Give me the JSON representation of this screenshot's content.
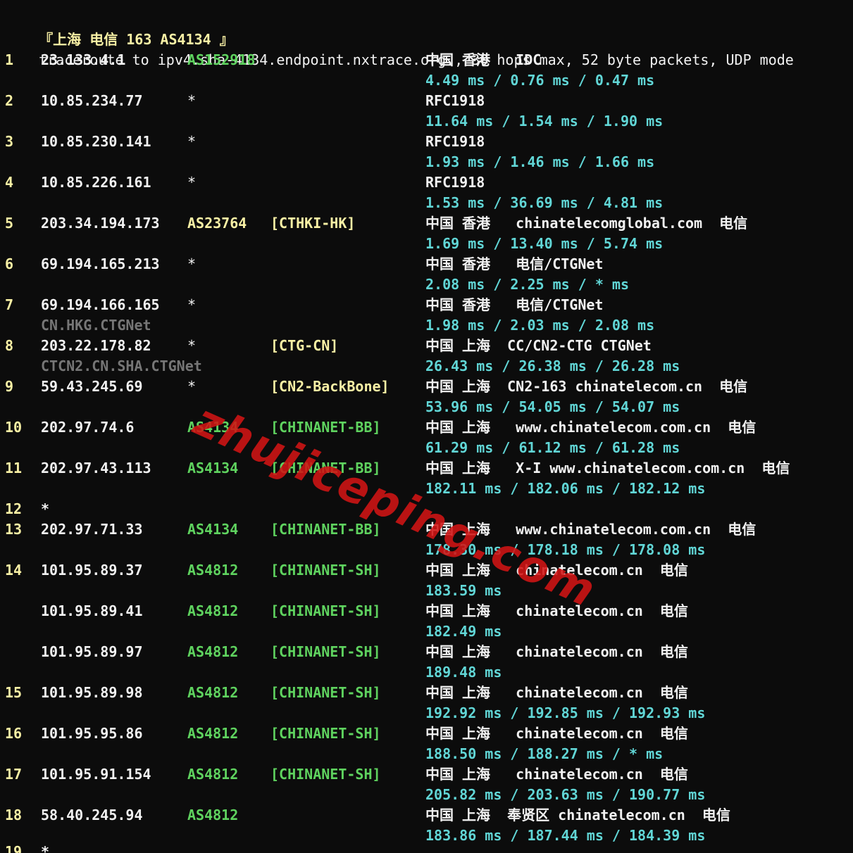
{
  "header": {
    "title": "『上海 电信 163 AS4134 』",
    "command": "traceroute to ipv4.sha-4134.endpoint.nxtrace.org., 30 hops max, 52 byte packets, UDP mode"
  },
  "watermark": "zhujiceping.com",
  "colors": {
    "hop": "#f9f1a5",
    "asn": "#5fd35f",
    "rtt": "#61d6d6",
    "rdns": "#767676",
    "background": "#0c0c0c"
  },
  "rows": [
    {
      "hop": "1",
      "ip": "23.133.4.1",
      "asn": "AS152918",
      "tag": "",
      "geo": "中国 香港   IDC",
      "rtt": "4.49 ms / 0.76 ms / 0.47 ms",
      "rdns": ""
    },
    {
      "hop": "2",
      "ip": "10.85.234.77",
      "asn": "*",
      "tag": "",
      "geo": "RFC1918",
      "rtt": "11.64 ms / 1.54 ms / 1.90 ms",
      "rdns": ""
    },
    {
      "hop": "3",
      "ip": "10.85.230.141",
      "asn": "*",
      "tag": "",
      "geo": "RFC1918",
      "rtt": "1.93 ms / 1.46 ms / 1.66 ms",
      "rdns": ""
    },
    {
      "hop": "4",
      "ip": "10.85.226.161",
      "asn": "*",
      "tag": "",
      "geo": "RFC1918",
      "rtt": "1.53 ms / 36.69 ms / 4.81 ms",
      "rdns": ""
    },
    {
      "hop": "5",
      "ip": "203.34.194.173",
      "asn": "AS23764",
      "tag": "[CTHKI-HK]",
      "geo": "中国 香港   chinatelecomglobal.com  电信",
      "rtt": "1.69 ms / 13.40 ms / 5.74 ms",
      "rdns": ""
    },
    {
      "hop": "6",
      "ip": "69.194.165.213",
      "asn": "*",
      "tag": "",
      "geo": "中国 香港   电信/CTGNet",
      "rtt": "2.08 ms / 2.25 ms / * ms",
      "rdns": ""
    },
    {
      "hop": "7",
      "ip": "69.194.166.165",
      "asn": "*",
      "tag": "",
      "geo": "中国 香港   电信/CTGNet",
      "rtt": "1.98 ms / 2.03 ms / 2.08 ms",
      "rdns": "CN.HKG.CTGNet"
    },
    {
      "hop": "8",
      "ip": "203.22.178.82",
      "asn": "*",
      "tag": "[CTG-CN]",
      "geo": "中国 上海  CC/CN2-CTG CTGNet",
      "rtt": "26.43 ms / 26.38 ms / 26.28 ms",
      "rdns": "CTCN2.CN.SHA.CTGNet"
    },
    {
      "hop": "9",
      "ip": "59.43.245.69",
      "asn": "*",
      "tag": "[CN2-BackBone]",
      "geo": "中国 上海  CN2-163 chinatelecom.cn  电信",
      "rtt": "53.96 ms / 54.05 ms / 54.07 ms",
      "rdns": ""
    },
    {
      "hop": "10",
      "ip": "202.97.74.6",
      "asn": "AS4134",
      "tag": "[CHINANET-BB]",
      "geo": "中国 上海   www.chinatelecom.com.cn  电信",
      "rtt": "61.29 ms / 61.12 ms / 61.28 ms",
      "rdns": ""
    },
    {
      "hop": "11",
      "ip": "202.97.43.113",
      "asn": "AS4134",
      "tag": "[CHINANET-BB]",
      "geo": "中国 上海   X-I www.chinatelecom.com.cn  电信",
      "rtt": "182.11 ms / 182.06 ms / 182.12 ms",
      "rdns": ""
    },
    {
      "hop": "12",
      "ip": "*",
      "asn": "",
      "tag": "",
      "geo": "",
      "rtt": "",
      "rdns": ""
    },
    {
      "hop": "13",
      "ip": "202.97.71.33",
      "asn": "AS4134",
      "tag": "[CHINANET-BB]",
      "geo": "中国 上海   www.chinatelecom.com.cn  电信",
      "rtt": "178.30 ms / 178.18 ms / 178.08 ms",
      "rdns": ""
    },
    {
      "hop": "14",
      "ip": "101.95.89.37",
      "asn": "AS4812",
      "tag": "[CHINANET-SH]",
      "geo": "中国 上海   chinatelecom.cn  电信",
      "rtt": "183.59 ms",
      "rdns": ""
    },
    {
      "hop": "",
      "ip": "101.95.89.41",
      "asn": "AS4812",
      "tag": "[CHINANET-SH]",
      "geo": "中国 上海   chinatelecom.cn  电信",
      "rtt": "182.49 ms",
      "rdns": ""
    },
    {
      "hop": "",
      "ip": "101.95.89.97",
      "asn": "AS4812",
      "tag": "[CHINANET-SH]",
      "geo": "中国 上海   chinatelecom.cn  电信",
      "rtt": "189.48 ms",
      "rdns": ""
    },
    {
      "hop": "15",
      "ip": "101.95.89.98",
      "asn": "AS4812",
      "tag": "[CHINANET-SH]",
      "geo": "中国 上海   chinatelecom.cn  电信",
      "rtt": "192.92 ms / 192.85 ms / 192.93 ms",
      "rdns": ""
    },
    {
      "hop": "16",
      "ip": "101.95.95.86",
      "asn": "AS4812",
      "tag": "[CHINANET-SH]",
      "geo": "中国 上海   chinatelecom.cn  电信",
      "rtt": "188.50 ms / 188.27 ms / * ms",
      "rdns": ""
    },
    {
      "hop": "17",
      "ip": "101.95.91.154",
      "asn": "AS4812",
      "tag": "[CHINANET-SH]",
      "geo": "中国 上海   chinatelecom.cn  电信",
      "rtt": "205.82 ms / 203.63 ms / 190.77 ms",
      "rdns": ""
    },
    {
      "hop": "18",
      "ip": "58.40.245.94",
      "asn": "AS4812",
      "tag": "",
      "geo": "中国 上海  奉贤区 chinatelecom.cn  电信",
      "rtt": "183.86 ms / 187.44 ms / 184.39 ms",
      "rdns": ""
    },
    {
      "hop": "19",
      "ip": "*",
      "asn": "",
      "tag": "",
      "geo": "",
      "rtt": "",
      "rdns": ""
    }
  ]
}
